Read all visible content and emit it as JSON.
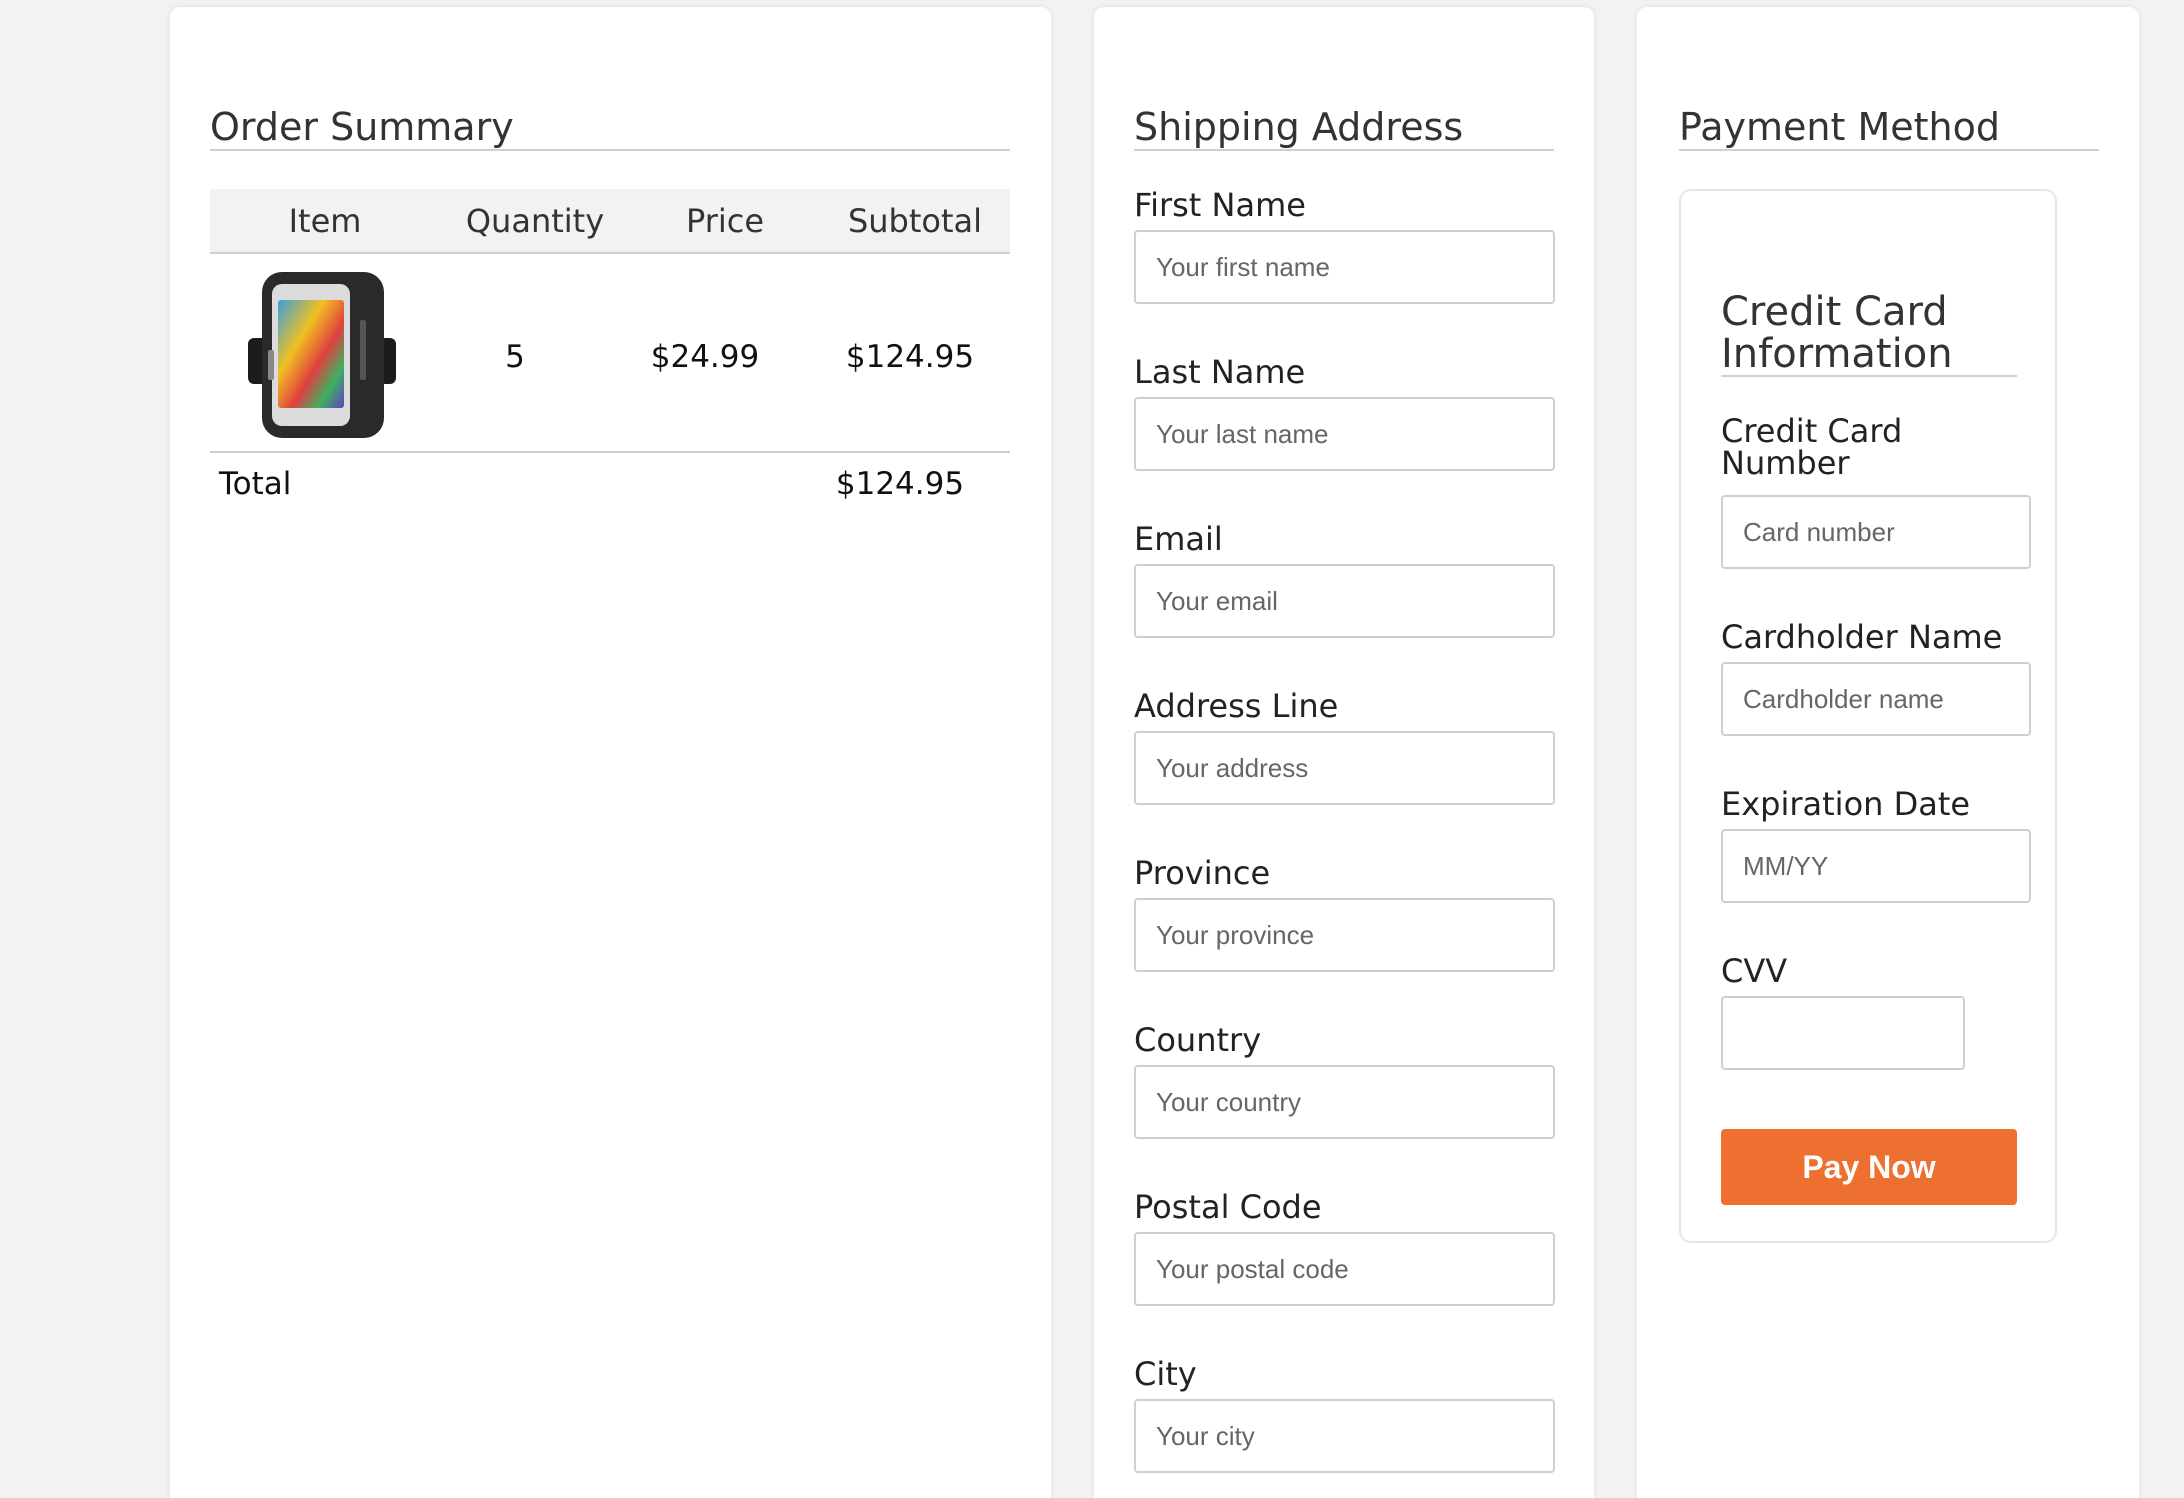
{
  "order_summary": {
    "title": "Order Summary",
    "columns": [
      "Item",
      "Quantity",
      "Price",
      "Subtotal"
    ],
    "rows": [
      {
        "item_image": "phone-armband-product-image",
        "quantity": "5",
        "price": "$24.99",
        "subtotal": "$124.95"
      }
    ],
    "total_label": "Total",
    "total_value": "$124.95"
  },
  "shipping": {
    "title": "Shipping Address",
    "fields": [
      {
        "label": "First Name",
        "placeholder": "Your first name"
      },
      {
        "label": "Last Name",
        "placeholder": "Your last name"
      },
      {
        "label": "Email",
        "placeholder": "Your email"
      },
      {
        "label": "Address Line",
        "placeholder": "Your address"
      },
      {
        "label": "Province",
        "placeholder": "Your province"
      },
      {
        "label": "Country",
        "placeholder": "Your country"
      },
      {
        "label": "Postal Code",
        "placeholder": "Your postal code"
      },
      {
        "label": "City",
        "placeholder": "Your city"
      }
    ]
  },
  "payment": {
    "title": "Payment Method",
    "card_title": "Credit Card Information",
    "fields": [
      {
        "label": "Credit Card Number",
        "placeholder": "Card number"
      },
      {
        "label": "Cardholder Name",
        "placeholder": "Cardholder name"
      },
      {
        "label": "Expiration Date",
        "placeholder": "MM/YY"
      },
      {
        "label": "CVV",
        "placeholder": ""
      }
    ],
    "pay_button": "Pay Now"
  },
  "colors": {
    "accent": "#ee7030",
    "background": "#f2f2f2",
    "panel": "#ffffff"
  }
}
